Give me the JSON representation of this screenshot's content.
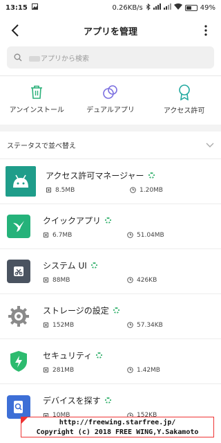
{
  "status_bar": {
    "time": "13:15",
    "net_speed": "0.26KB/s",
    "battery": "49%"
  },
  "header": {
    "title": "アプリを管理"
  },
  "search": {
    "placeholder": "アプリから検索"
  },
  "actions": [
    {
      "label": "アンインストール",
      "icon": "trash-icon"
    },
    {
      "label": "デュアルアプリ",
      "icon": "dual-app-icon"
    },
    {
      "label": "アクセス許可",
      "icon": "permission-badge-icon"
    }
  ],
  "sort": {
    "label": "ステータスで並べ替え"
  },
  "apps": [
    {
      "name": "アクセス許可マネージャー",
      "storage": "8.5MB",
      "data": "1.20MB",
      "icon": "android-icon",
      "color": "#1f9d8a"
    },
    {
      "name": "クイックアプリ",
      "storage": "6.7MB",
      "data": "51.04MB",
      "icon": "hummingbird-icon",
      "color": "#25b27a"
    },
    {
      "name": "システム UI",
      "storage": "88MB",
      "data": "426KB",
      "icon": "system-ui-icon",
      "color": "#4a5360"
    },
    {
      "name": "ストレージの設定",
      "storage": "152MB",
      "data": "57.34KB",
      "icon": "gear-icon",
      "color": "#8a8a8a"
    },
    {
      "name": "セキュリティ",
      "storage": "281MB",
      "data": "1.42MB",
      "icon": "shield-icon",
      "color": "#2dbb6f"
    },
    {
      "name": "デバイスを探す",
      "storage": "10MB",
      "data": "152KB",
      "icon": "find-device-icon",
      "color": "#3d6fd6"
    }
  ],
  "footer": {
    "line1": "http://freewing.starfree.jp/",
    "line2": "Copyright (c) 2018 FREE WING,Y.Sakamoto"
  }
}
